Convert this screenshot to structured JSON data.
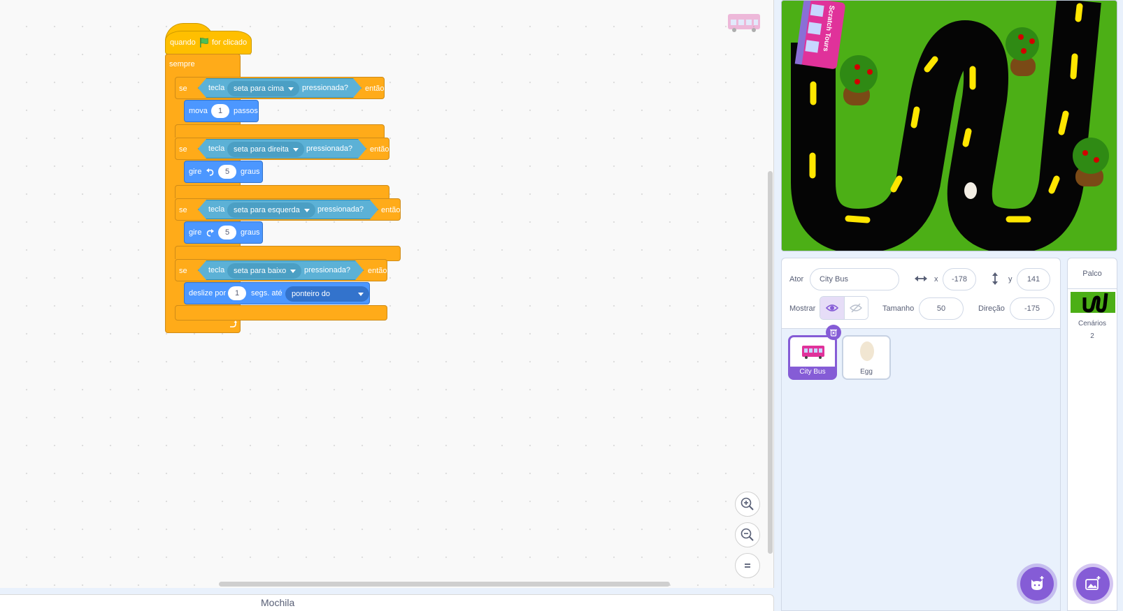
{
  "colors": {
    "events": "#ffbf00",
    "control": "#ffab19",
    "motion": "#4c97ff",
    "sensing": "#5cb1d6",
    "accent": "#855cd6",
    "stage_grass": "#4caf16"
  },
  "script": {
    "hat": {
      "pre": "quando",
      "flag_icon": "green-flag-icon",
      "post": "for clicado"
    },
    "forever": "sempre",
    "if1": {
      "se": "se",
      "key": "tecla",
      "dropdown": "seta para cima",
      "pressed": "pressionada?",
      "then": "então"
    },
    "move": {
      "label": "mova",
      "value": "1",
      "unit": "passos"
    },
    "if2": {
      "se": "se",
      "key": "tecla",
      "dropdown": "seta para direita",
      "pressed": "pressionada?",
      "then": "então"
    },
    "turn_left": {
      "label": "gire",
      "icon": "rotate-left-icon",
      "value": "5",
      "unit": "graus"
    },
    "if3": {
      "se": "se",
      "key": "tecla",
      "dropdown": "seta para esquerda",
      "pressed": "pressionada?",
      "then": "então"
    },
    "turn_right": {
      "label": "gire",
      "icon": "rotate-right-icon",
      "value": "5",
      "unit": "graus"
    },
    "if4": {
      "se": "se",
      "key": "tecla",
      "dropdown": "seta para baixo",
      "pressed": "pressionada?",
      "then": "então"
    },
    "glide": {
      "label": "deslize por",
      "value": "1",
      "mid": "segs. até",
      "dropdown": "ponteiro do mouse"
    }
  },
  "backpack": {
    "label": "Mochila"
  },
  "sprite_info": {
    "sprite_label": "Ator",
    "sprite_name": "City Bus",
    "x_label": "x",
    "x_value": "-178",
    "y_label": "y",
    "y_value": "141",
    "show_label": "Mostrar",
    "size_label": "Tamanho",
    "size_value": "50",
    "direction_label": "Direção",
    "direction_value": "-175"
  },
  "sprites": [
    {
      "name": "City Bus",
      "selected": true
    },
    {
      "name": "Egg",
      "selected": false
    }
  ],
  "stage_panel": {
    "title": "Palco",
    "backdrops_label": "Cenários",
    "backdrops_count": "2"
  },
  "stage_bus_text": "Scratch Tours"
}
